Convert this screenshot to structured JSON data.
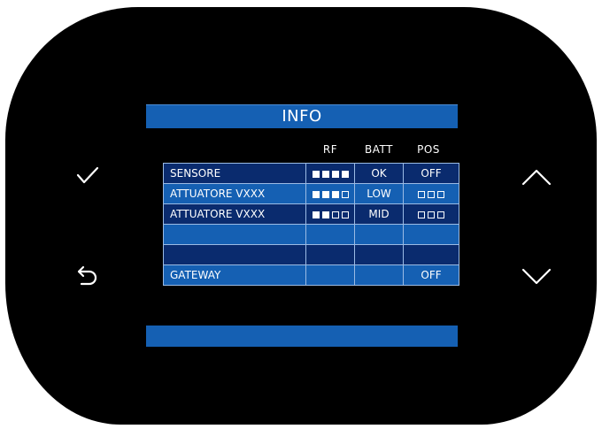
{
  "screen": {
    "title": "INFO",
    "columns": {
      "rf": "RF",
      "batt": "BATT",
      "pos": "POS"
    },
    "rows": [
      {
        "name": "SENSORE",
        "rf": [
          1,
          1,
          1,
          1
        ],
        "batt": "OK",
        "pos_text": "OFF",
        "pos_squares": []
      },
      {
        "name": "ATTUATORE VXXX",
        "rf": [
          1,
          1,
          1,
          0
        ],
        "batt": "LOW",
        "pos_text": "",
        "pos_squares": [
          0,
          0,
          0
        ]
      },
      {
        "name": "ATTUATORE VXXX",
        "rf": [
          1,
          1,
          0,
          0
        ],
        "batt": "MID",
        "pos_text": "",
        "pos_squares": [
          0,
          0,
          0
        ]
      },
      {
        "name": "",
        "rf": [],
        "batt": "",
        "pos_text": "",
        "pos_squares": []
      },
      {
        "name": "",
        "rf": [],
        "batt": "",
        "pos_text": "",
        "pos_squares": []
      },
      {
        "name": "GATEWAY",
        "rf": [],
        "batt": "",
        "pos_text": "OFF",
        "pos_squares": []
      }
    ]
  },
  "buttons": {
    "confirm": "check-icon",
    "back": "back-arrow-icon",
    "up": "chevron-up-icon",
    "down": "chevron-down-icon"
  },
  "colors": {
    "accent_blue": "#1560b3",
    "dark_blue": "#0a2b6e",
    "device_body": "#000000"
  }
}
